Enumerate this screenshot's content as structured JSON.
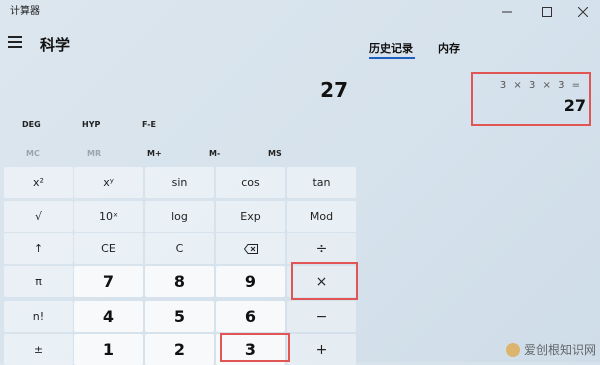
{
  "window": {
    "title": "计算器"
  },
  "header": {
    "mode": "科学",
    "tabs": [
      "历史记录",
      "内存"
    ]
  },
  "display": {
    "value": "27"
  },
  "history": {
    "expression": "3 × 3 × 3 =",
    "result": "27"
  },
  "mode_row": {
    "deg": "DEG",
    "hyp": "HYP",
    "fe": "F-E"
  },
  "memory_row": [
    "MC",
    "MR",
    "M+",
    "M-",
    "MS"
  ],
  "keys": {
    "r1": [
      "x²",
      "xʸ",
      "sin",
      "cos",
      "tan"
    ],
    "r2": [
      "√",
      "10ˣ",
      "log",
      "Exp",
      "Mod"
    ],
    "r3": [
      "↑",
      "CE",
      "C",
      "⌫",
      "÷"
    ],
    "r4": [
      "π",
      "7",
      "8",
      "9",
      "×"
    ],
    "r5": [
      "n!",
      "4",
      "5",
      "6",
      "−"
    ],
    "r6": [
      "±",
      "1",
      "2",
      "3",
      "+"
    ]
  },
  "watermark": {
    "text": "爱创根知识网"
  },
  "icons": {
    "minimize": "minimize-icon",
    "maximize": "maximize-icon",
    "close": "close-icon",
    "menu": "hamburger-icon",
    "backspace": "backspace-icon"
  },
  "colors": {
    "highlight": "#e25555",
    "accent": "#1f5fbf"
  }
}
